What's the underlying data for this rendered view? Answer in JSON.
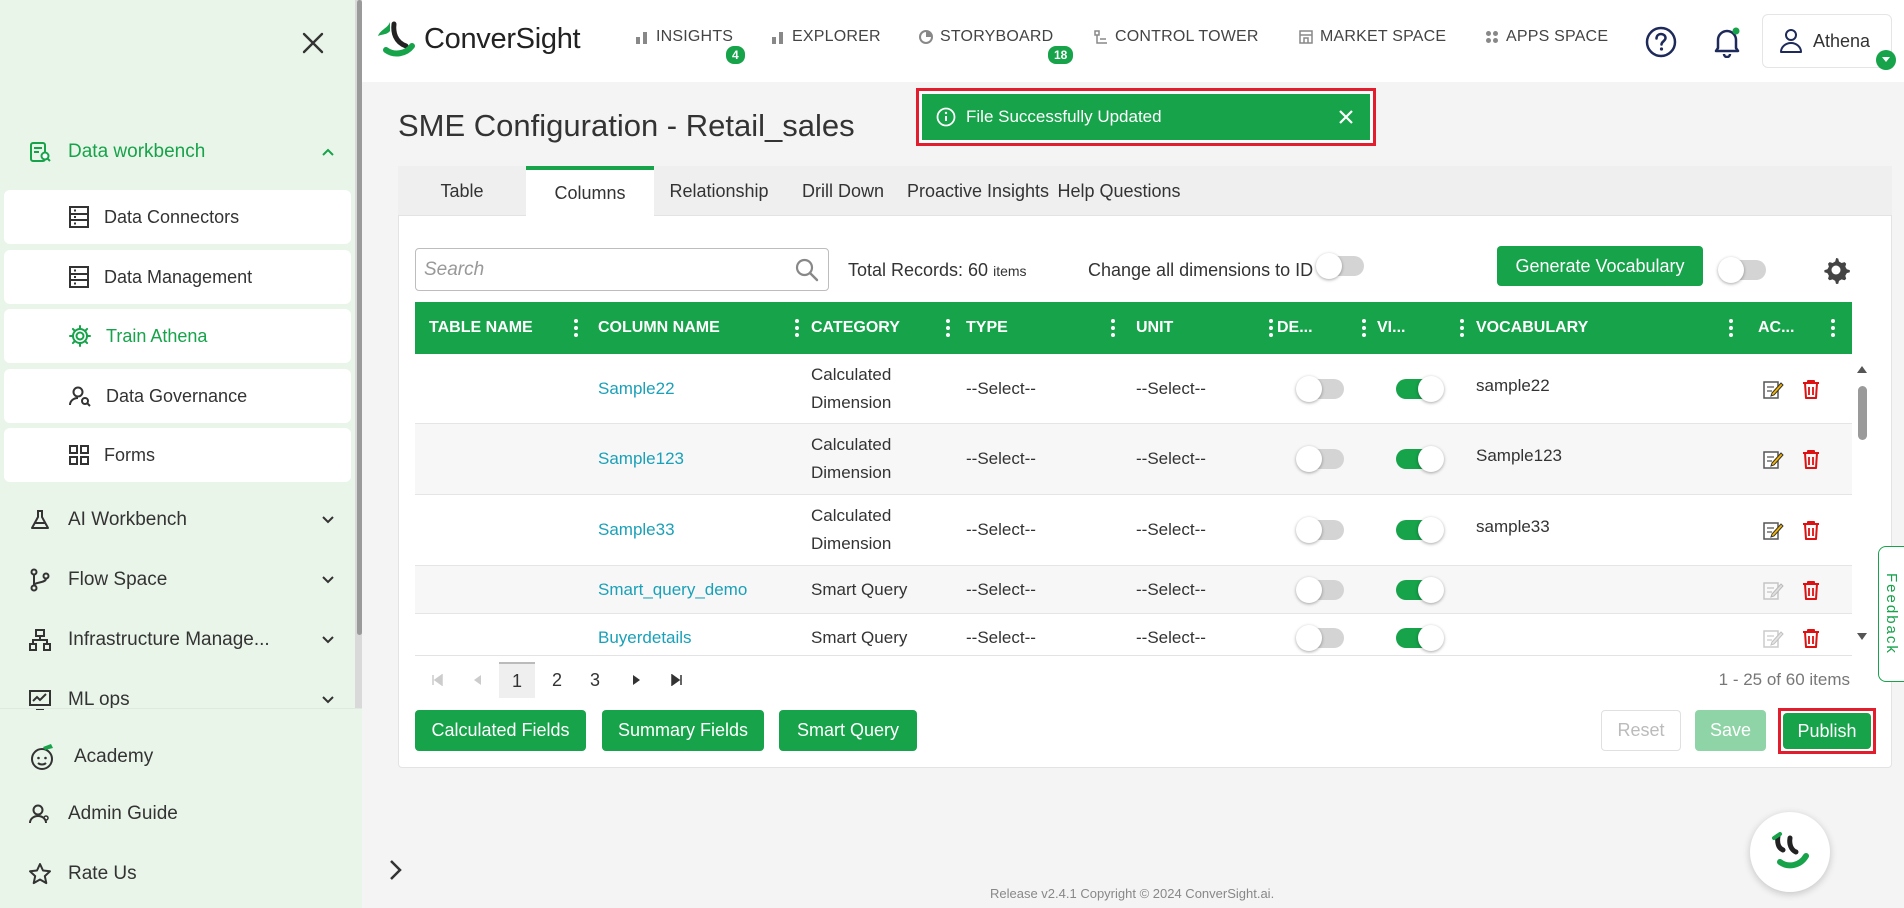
{
  "sidebar": {
    "groups": {
      "data_workbench": "Data workbench",
      "ai_workbench": "AI Workbench",
      "flow_space": "Flow Space",
      "infra": "Infrastructure Manage...",
      "ml_ops": "ML ops"
    },
    "sub_items": {
      "data_connectors": "Data Connectors",
      "data_management": "Data Management",
      "train_athena": "Train Athena",
      "data_governance": "Data Governance",
      "forms": "Forms"
    },
    "bottom": {
      "academy": "Academy",
      "admin_guide": "Admin Guide",
      "rate_us": "Rate Us"
    }
  },
  "header": {
    "brand": "ConverSight",
    "menu": {
      "insights": "INSIGHTS",
      "insights_badge": "4",
      "explorer": "EXPLORER",
      "storyboard": "STORYBOARD",
      "storyboard_badge": "18",
      "control_tower": "CONTROL TOWER",
      "market_space": "MARKET SPACE",
      "apps_space": "APPS SPACE"
    },
    "user": "Athena"
  },
  "page": {
    "title": "SME Configuration - Retail_sales",
    "toast": "File Successfully Updated"
  },
  "tabs": {
    "table": "Table",
    "columns": "Columns",
    "relationship": "Relationship",
    "drill_down": "Drill Down",
    "proactive": "Proactive Insights",
    "help": "Help Questions"
  },
  "toolbar": {
    "search_placeholder": "Search",
    "total_prefix": "Total Records: 60",
    "total_suffix": "items",
    "change_label": "Change all dimensions to ID",
    "generate": "Generate Vocabulary"
  },
  "table": {
    "headers": {
      "table_name": "TABLE NAME",
      "column_name": "COLUMN NAME",
      "category": "CATEGORY",
      "type": "TYPE",
      "unit": "UNIT",
      "de": "DE...",
      "vi": "VI...",
      "vocabulary": "VOCABULARY",
      "ac": "AC..."
    },
    "rows": [
      {
        "column": "Sample22",
        "cat1": "Calculated",
        "cat2": "Dimension",
        "type": "--Select--",
        "unit": "--Select--",
        "vocab": "sample22"
      },
      {
        "column": "Sample123",
        "cat1": "Calculated",
        "cat2": "Dimension",
        "type": "--Select--",
        "unit": "--Select--",
        "vocab": "Sample123"
      },
      {
        "column": "Sample33",
        "cat1": "Calculated",
        "cat2": "Dimension",
        "type": "--Select--",
        "unit": "--Select--",
        "vocab": "sample33"
      },
      {
        "column": "Smart_query_demo",
        "cat1": "Smart Query",
        "type": "--Select--",
        "unit": "--Select--",
        "vocab": ""
      },
      {
        "column": "Buyerdetails",
        "cat1": "Smart Query",
        "type": "--Select--",
        "unit": "--Select--",
        "vocab": ""
      }
    ]
  },
  "pager": {
    "p1": "1",
    "p2": "2",
    "p3": "3",
    "info": "1 - 25 of 60 items"
  },
  "actions": {
    "calculated": "Calculated Fields",
    "summary": "Summary Fields",
    "smart_query": "Smart Query",
    "reset": "Reset",
    "save": "Save",
    "publish": "Publish"
  },
  "feedback": "Feedback",
  "footer": "Release v2.4.1 Copyright © 2024 ConverSight.ai.",
  "colors": {
    "accent": "#16a34a",
    "highlight": "#e11d2e",
    "link": "#1aa0b8"
  }
}
